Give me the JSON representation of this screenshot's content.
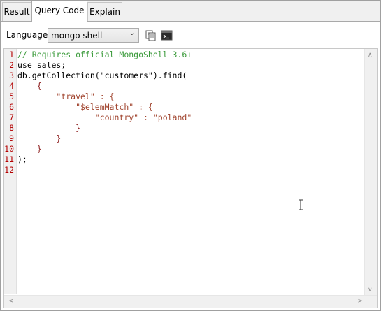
{
  "tabs": [
    {
      "label": "Result",
      "active": false
    },
    {
      "label": "Query Code",
      "active": true
    },
    {
      "label": "Explain",
      "active": false
    }
  ],
  "toolbar": {
    "language_label": "Language:",
    "language_value": "mongo shell",
    "copy_icon": "copy-icon",
    "shell_icon": "open-in-shell-icon"
  },
  "editor": {
    "line_numbers": [
      "1",
      "2",
      "3",
      "4",
      "5",
      "6",
      "7",
      "8",
      "9",
      "10",
      "11",
      "12"
    ],
    "lines": [
      "// Requires official MongoShell 3.6+",
      "use sales;",
      "db.getCollection(\"customers\").find(",
      "    {",
      "        \"travel\" : {",
      "            \"$elemMatch\" : {",
      "                \"country\" : \"poland\"",
      "            }",
      "        }",
      "    }",
      ");",
      ""
    ]
  },
  "colors": {
    "comment": "#3a9a3a",
    "string": "#a0432d",
    "brace": "#8b1a1a",
    "line_number": "#b40000"
  }
}
